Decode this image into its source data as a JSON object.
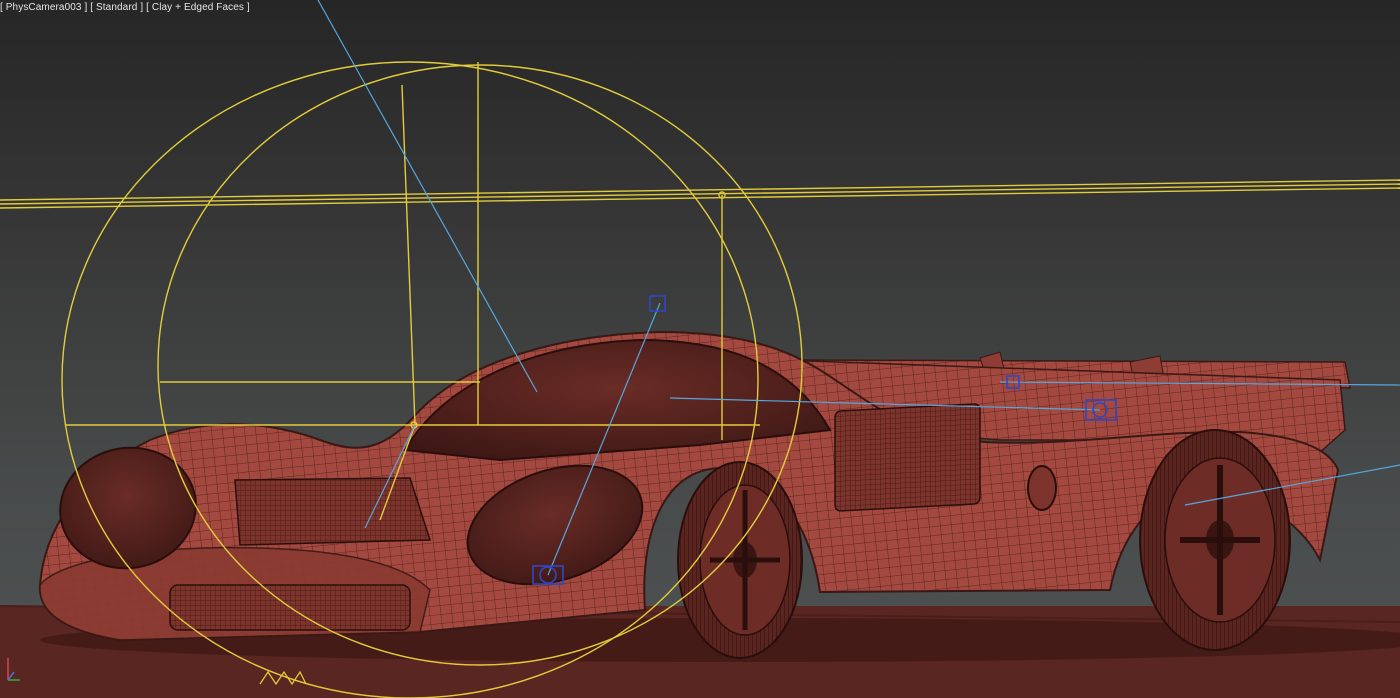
{
  "viewport": {
    "label_parts": [
      "[",
      "PhysCamera003",
      "]",
      "[",
      "Standard",
      "]",
      "[",
      "Clay + Edged Faces",
      "]"
    ],
    "camera_menu": "PhysCamera003",
    "shading_mode_menu": "Standard",
    "display_mode_menu": "Clay + Edged Faces"
  },
  "colors": {
    "floor": "#5a2621",
    "car_body": "#a4493f",
    "car_dark": "#3a1815",
    "light_helper": "#e3cc3b",
    "target_line": "#58a6dc",
    "light_icon": "#2e47c8"
  },
  "icons": {
    "axis_gizmo": "axis-tripod",
    "light_helpers": "photometric-light-sphere",
    "light_targets": "light-target-box"
  }
}
